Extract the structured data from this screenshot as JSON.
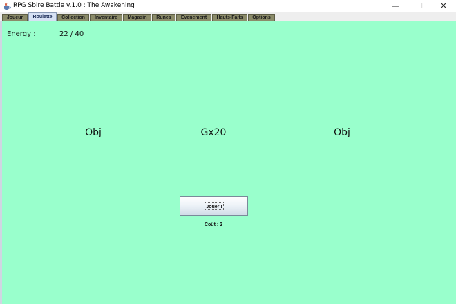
{
  "window": {
    "title": "RPG Sbire Battle v.1.0 : The Awakening",
    "minimize_glyph": "—",
    "maximize_glyph": "☐",
    "close_glyph": "✕",
    "icon": "java-cup-icon"
  },
  "tabs": [
    {
      "label": "Joueur",
      "active": false
    },
    {
      "label": "Roulette",
      "active": true
    },
    {
      "label": "Collection",
      "active": false
    },
    {
      "label": "Inventaire",
      "active": false
    },
    {
      "label": "Magasin",
      "active": false
    },
    {
      "label": "Runes",
      "active": false
    },
    {
      "label": "Evenement",
      "active": false
    },
    {
      "label": "Hauts-Faits",
      "active": false
    },
    {
      "label": "Options",
      "active": false
    }
  ],
  "roulette": {
    "energy_label": "Energy :",
    "energy_value": "22 / 40",
    "slots": [
      "Obj",
      "Gx20",
      "Obj"
    ],
    "play_button": "Jouer !",
    "cost": "Coût : 2"
  },
  "colors": {
    "panel_background": "#99ffcc",
    "tab_inactive": "#8b8b69",
    "tab_active": "#d7e2f4"
  }
}
